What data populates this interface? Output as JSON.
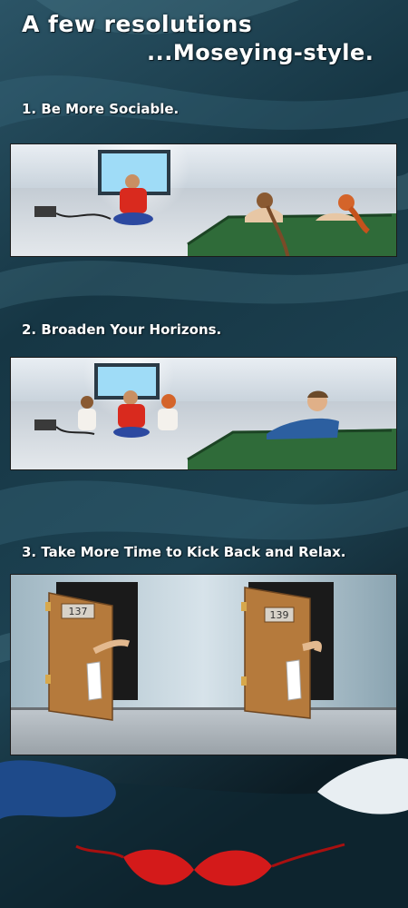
{
  "title": {
    "line1": "A few resolutions",
    "line2": "...Moseying-style."
  },
  "resolutions": [
    {
      "label": "1. Be More Sociable."
    },
    {
      "label": "2. Broaden Your Horizons."
    },
    {
      "label": "3. Take More Time to Kick Back and Relax."
    }
  ],
  "doors": [
    {
      "number": "137"
    },
    {
      "number": "139"
    }
  ],
  "colors": {
    "background": "#10242f",
    "caption_text": "#ffffff",
    "couch": "#2f6b39",
    "shirt_red": "#d92a1e",
    "door_wood": "#b57a3c",
    "bra_red": "#d41a1a"
  }
}
